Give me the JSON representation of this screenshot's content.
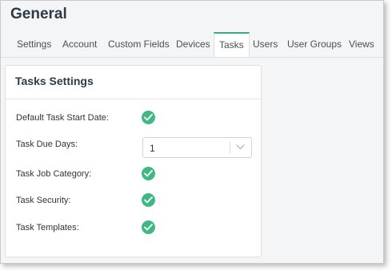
{
  "page": {
    "title": "General"
  },
  "tabs": [
    {
      "label": "Settings"
    },
    {
      "label": "Account"
    },
    {
      "label": "Custom Fields"
    },
    {
      "label": "Devices"
    },
    {
      "label": "Tasks"
    },
    {
      "label": "Users"
    },
    {
      "label": "User Groups"
    },
    {
      "label": "Views"
    }
  ],
  "active_tab": "Tasks",
  "card": {
    "title": "Tasks Settings",
    "rows": [
      {
        "label": "Default Task Start Date:",
        "control": "check",
        "checked": true
      },
      {
        "label": "Task Due Days:",
        "control": "select",
        "value": "1"
      },
      {
        "label": "Task Job Category:",
        "control": "check",
        "checked": true
      },
      {
        "label": "Task Security:",
        "control": "check",
        "checked": true
      },
      {
        "label": "Task Templates:",
        "control": "check",
        "checked": true
      }
    ]
  },
  "colors": {
    "accent": "#3fb883",
    "active_tab_border": "#34b07a"
  },
  "icons": {
    "check": "check-circle-icon",
    "dropdown": "chevron-down-icon"
  }
}
